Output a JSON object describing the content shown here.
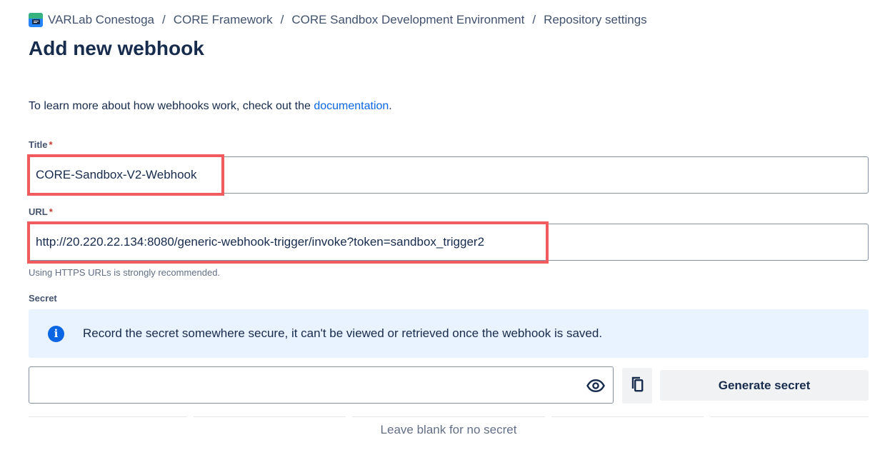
{
  "breadcrumb": {
    "items": [
      "VARLab Conestoga",
      "CORE Framework",
      "CORE Sandbox Development Environment",
      "Repository settings"
    ],
    "separator": "/",
    "logo_icon": "repository-logo-icon"
  },
  "page_title": "Add new webhook",
  "intro": {
    "text": "To learn more about how webhooks work, check out the ",
    "link_text": "documentation",
    "suffix": "."
  },
  "form": {
    "title_label": "Title",
    "title_value": "CORE-Sandbox-V2-Webhook",
    "url_label": "URL",
    "url_value": "http://20.220.22.134:8080/generic-webhook-trigger/invoke?token=sandbox_trigger2",
    "url_helper": "Using HTTPS URLs is strongly recommended.",
    "required_marker": "*",
    "secret_label": "Secret",
    "secret_value": "",
    "info_message": "Record the secret somewhere secure, it can't be viewed or retrieved once the webhook is saved.",
    "info_icon_glyph": "i",
    "generate_secret_label": "Generate secret",
    "blank_hint": "Leave blank for no secret"
  },
  "icons": {
    "info": "info-icon",
    "eye": "eye-icon",
    "copy": "copy-icon"
  },
  "colors": {
    "highlight": "#f15b5e",
    "link": "#0c66e4",
    "info_bg": "#e9f2ff"
  }
}
